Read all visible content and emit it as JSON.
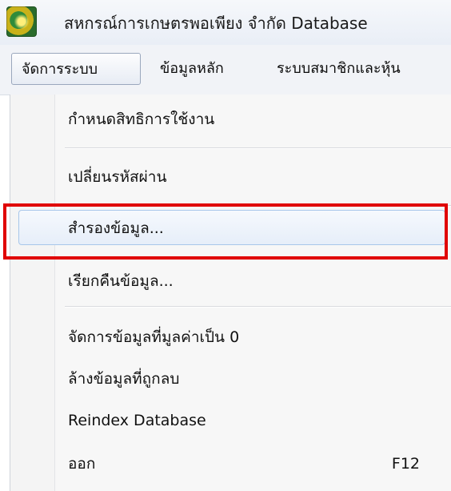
{
  "window": {
    "title": "สหกรณ์การเกษตรพอเพียง จำกัด Database"
  },
  "menubar": {
    "items": [
      {
        "label": "จัดการระบบ"
      },
      {
        "label": "ข้อมูลหลัก"
      },
      {
        "label": "ระบบสมาชิกและหุ้น"
      }
    ]
  },
  "dropdown": {
    "items": [
      {
        "label": "กำหนดสิทธิการใช้งาน"
      },
      {
        "label": "เปลี่ยนรหัสผ่าน"
      },
      {
        "label": "สำรองข้อมูล..."
      },
      {
        "label": "เรียกคืนข้อมูล..."
      },
      {
        "label": "จัดการข้อมูลที่มูลค่าเป็น 0"
      },
      {
        "label": "ล้างข้อมูลที่ถูกลบ"
      },
      {
        "label": "Reindex Database"
      },
      {
        "label": "ออก",
        "shortcut": "F12"
      }
    ]
  },
  "colors": {
    "highlight_border": "#e00000",
    "hover_border": "#a8c7ea"
  }
}
